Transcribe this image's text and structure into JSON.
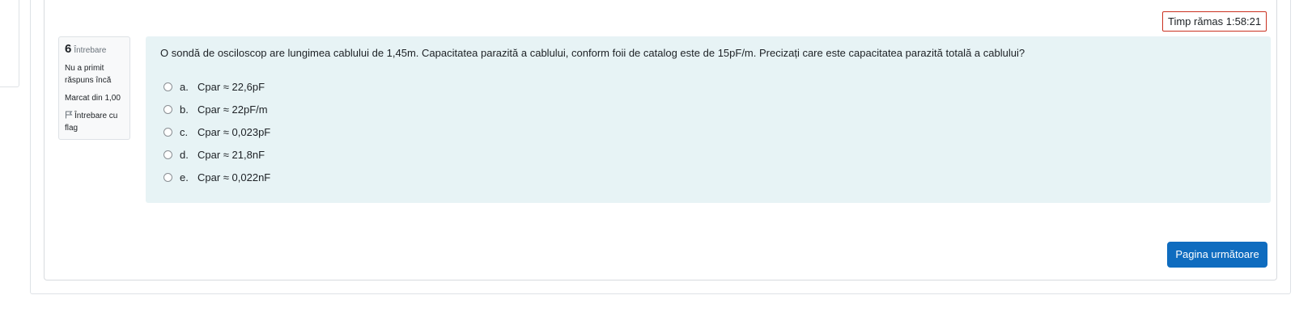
{
  "timer": {
    "text": "Timp rămas 1:58:21"
  },
  "question_info": {
    "number": "6",
    "number_word": "Întrebare",
    "state": "Nu a primit răspuns încă",
    "grade": "Marcat din 1,00",
    "flag_label": "Întrebare cu flag"
  },
  "question": {
    "text": "O sondă de osciloscop are lungimea cablului de 1,45m. Capacitatea parazită a cablului, conform foii de catalog este de 15pF/m. Precizați care este capacitatea parazită totală a cablului?",
    "answers": [
      {
        "letter": "a.",
        "text": "Cpar ≈ 22,6pF"
      },
      {
        "letter": "b.",
        "text": "Cpar ≈ 22pF/m"
      },
      {
        "letter": "c.",
        "text": "Cpar ≈ 0,023pF"
      },
      {
        "letter": "d.",
        "text": "Cpar ≈ 21,8nF"
      },
      {
        "letter": "e.",
        "text": "Cpar ≈ 0,022nF"
      }
    ]
  },
  "navigation": {
    "next_label": "Pagina următoare"
  },
  "colors": {
    "accent": "#0f6cbf",
    "timer_border": "#ca3120",
    "formulation_bg": "#e7f3f5",
    "info_bg": "#f8f9fa"
  }
}
